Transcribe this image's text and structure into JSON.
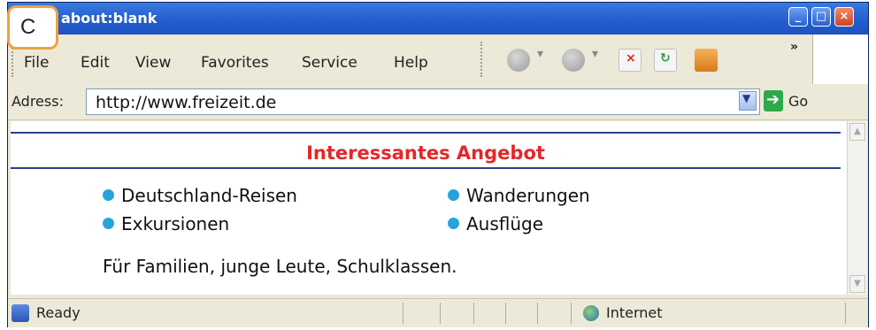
{
  "window": {
    "title": "about:blank"
  },
  "badge": {
    "label": "C"
  },
  "menu": {
    "items": [
      "File",
      "Edit",
      "View",
      "Favorites",
      "Service",
      "Help"
    ]
  },
  "address": {
    "label": "Adress:",
    "url": "http://www.freizeit.de",
    "go_label": "Go"
  },
  "page": {
    "headline": "Interessantes Angebot",
    "bullets_left": [
      "Deutschland-Reisen",
      "Exkursionen"
    ],
    "bullets_right": [
      "Wanderungen",
      "Ausflüge"
    ],
    "footer": "Für Familien, junge Leute, Schulklassen."
  },
  "status": {
    "left": "Ready",
    "zone": "Internet"
  },
  "colors": {
    "headline": "#e3272a",
    "bullet": "#27a3dc",
    "titlebar": "#2660cf",
    "rule": "#2c3f8e"
  }
}
